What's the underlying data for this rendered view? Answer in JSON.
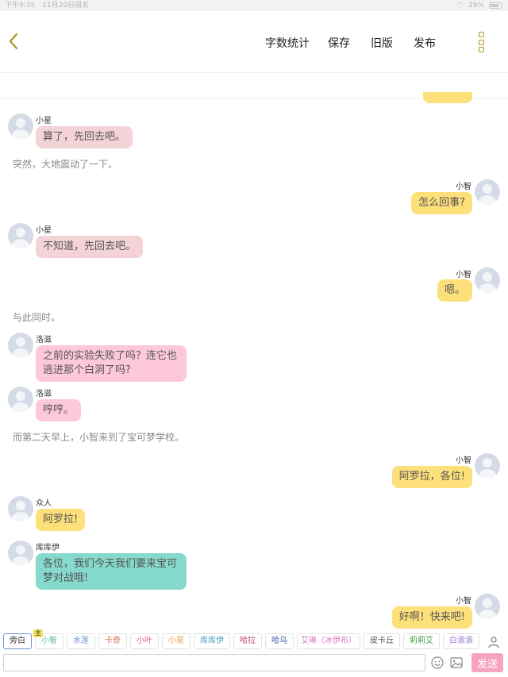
{
  "status_bar": {
    "time": "下午9:35",
    "date": "11月20日周五",
    "battery": "29%"
  },
  "header": {
    "back_icon": "chevron-left-icon",
    "word_count_label": "字数统计",
    "save_label": "保存",
    "old_version_label": "旧版",
    "publish_label": "发布",
    "more_icon": "more-vertical-icon",
    "accent_color": "#a89a1c"
  },
  "messages": [
    {
      "type": "left",
      "name": "小星",
      "text": "算了，先回去吧。",
      "color": "#f3d3d6"
    },
    {
      "type": "narration",
      "text": "突然，大地震动了一下。"
    },
    {
      "type": "right",
      "name": "小智",
      "text": "怎么回事?",
      "color": "#fde07a"
    },
    {
      "type": "left",
      "name": "小星",
      "text": "不知道，先回去吧。",
      "color": "#f3d3d6"
    },
    {
      "type": "right",
      "name": "小智",
      "text": "嗯。",
      "color": "#fde07a"
    },
    {
      "type": "narration",
      "text": "与此同时。"
    },
    {
      "type": "left",
      "name": "洛滋",
      "text": "之前的实验失败了吗？连它也逃进那个白洞了吗?",
      "color": "#fdc9d9"
    },
    {
      "type": "left",
      "name": "洛滋",
      "text": "哼哼。",
      "color": "#fdc9d9"
    },
    {
      "type": "narration",
      "text": "而第二天早上，小智来到了宝可梦学校。"
    },
    {
      "type": "right",
      "name": "小智",
      "text": "阿罗拉，各位!",
      "color": "#fde07a"
    },
    {
      "type": "left",
      "name": "众人",
      "text": "阿罗拉!",
      "color": "#fde07a"
    },
    {
      "type": "left",
      "name": "库库伊",
      "text": "各位，我们今天我们要来宝可梦对战哦!",
      "color": "#86d9cd"
    },
    {
      "type": "right",
      "name": "小智",
      "text": "好啊！快来吧!",
      "color": "#fde07a"
    }
  ],
  "characters": [
    {
      "label": "旁白",
      "color": "#333333"
    },
    {
      "label": "小智",
      "color": "#5bb7a0",
      "badge": "主"
    },
    {
      "label": "水莲",
      "color": "#6f8fd8"
    },
    {
      "label": "卡奇",
      "color": "#e06b5a"
    },
    {
      "label": "小叶",
      "color": "#e05a7a"
    },
    {
      "label": "小星",
      "color": "#e8a24a"
    },
    {
      "label": "库库伊",
      "color": "#4aa8c0"
    },
    {
      "label": "哈拉",
      "color": "#c0407a"
    },
    {
      "label": "哈乌",
      "color": "#3a5fa8"
    },
    {
      "label": "艾琳（冰伊布）",
      "color": "#d879c8"
    },
    {
      "label": "皮卡丘",
      "color": "#555555"
    },
    {
      "label": "莉莉艾",
      "color": "#4a9a4a"
    },
    {
      "label": "白滚滚",
      "color": "#9a7ad0"
    }
  ],
  "person_icon": "person-icon",
  "input": {
    "value": "",
    "placeholder": ""
  },
  "emoji_icon": "emoji-icon",
  "image_icon": "image-icon",
  "send_label": "发送",
  "send_color": "#f6a3c1"
}
